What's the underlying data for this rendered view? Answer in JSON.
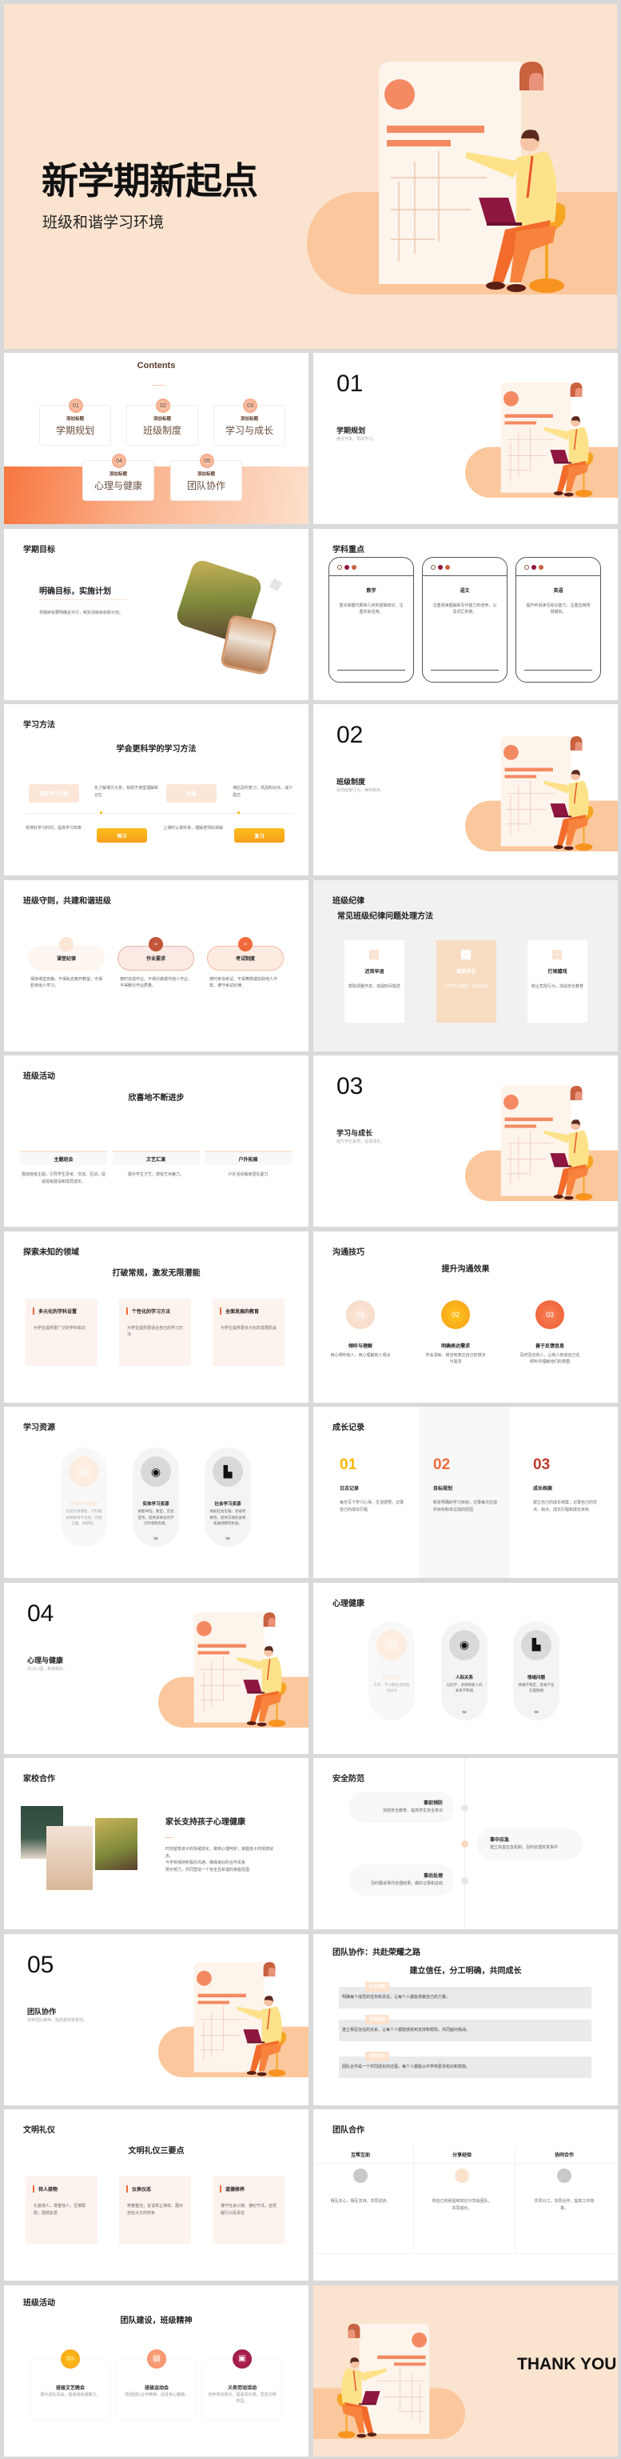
{
  "cover": {
    "title": "新学期新起点",
    "subtitle": "班级和谐学习环境"
  },
  "contents": {
    "title": "Contents",
    "items": [
      {
        "num": "01",
        "tag": "添加标题",
        "label": "学期规划"
      },
      {
        "num": "02",
        "tag": "添加标题",
        "label": "班级制度"
      },
      {
        "num": "03",
        "tag": "添加标题",
        "label": "学习与成长"
      },
      {
        "num": "04",
        "tag": "添加标题",
        "label": "心理与健康"
      },
      {
        "num": "05",
        "tag": "添加标题",
        "label": "团队协作"
      }
    ]
  },
  "sections": [
    {
      "num": "01",
      "title": "学期规划",
      "desc": "继往开来，再启学习。"
    },
    {
      "num": "02",
      "title": "班级制度",
      "desc": "规范班级行为，维持秩序。"
    },
    {
      "num": "03",
      "title": "学习与成长",
      "desc": "提升学生素质，促进成长。"
    },
    {
      "num": "04",
      "title": "心理与健康",
      "desc": "关注心理，和谐相处。"
    },
    {
      "num": "05",
      "title": "团队协作",
      "desc": "培养团队精神，提高整体荣誉感。"
    }
  ],
  "goals": {
    "header": "学期目标",
    "heading": "明确目标，实施计划",
    "body": "学期目标要明确且可行，制定清晰目标和计划。"
  },
  "subjects": {
    "header": "学科重点",
    "items": [
      {
        "title": "数学",
        "text": "重点掌握代数和几何的基础知识，注重实际应用。"
      },
      {
        "title": "语文",
        "text": "注重阅读理解和写作能力的培养，以及词汇积累。"
      },
      {
        "title": "英语",
        "text": "提升听说读写综合能力，注重应用场景模拟。"
      }
    ]
  },
  "methods": {
    "header": "学习方法",
    "heading": "学会更科学的学习方法",
    "steps": [
      {
        "label": "制定学习计划",
        "text": "安排好学习时间，提高学习效率"
      },
      {
        "label": "预习",
        "text": "先了解课文大意，有助于课堂理解和记忆"
      },
      {
        "label": "听课",
        "text": "上课时认真听讲，理解老师的讲解"
      },
      {
        "label": "复习",
        "text": "课后及时复习，巩固知识点，减少遗忘"
      }
    ]
  },
  "rules": {
    "header": "班级守则，共建和谐班级",
    "items": [
      {
        "num": "01",
        "title": "课堂纪律",
        "text": "保持课堂安静，不得私自离开教室，不得影响他人学习。"
      },
      {
        "num": "02",
        "title": "作业要求",
        "text": "按时完成作业，不得抄袭或代他人作业，不得敷衍作业质量。"
      },
      {
        "num": "03",
        "title": "考试制度",
        "text": "按时参加考试，不得舞弊或协助他人作弊，遵守考试纪律。"
      }
    ]
  },
  "discipline": {
    "header": "班级纪律",
    "heading": "常见班级纪律问题处理方法",
    "items": [
      {
        "icon": "01",
        "title": "迟到早退",
        "text": "帮助调整作息，加强时间观念"
      },
      {
        "icon": "02",
        "title": "课堂讲话",
        "text": "引导专注课堂，适当提醒"
      },
      {
        "icon": "03",
        "title": "打闹嬉戏",
        "text": "制止危险行为，加强安全教育"
      }
    ]
  },
  "activities": {
    "header": "班级活动",
    "heading": "欣喜地不断进步",
    "items": [
      {
        "title": "主题班会",
        "text": "围绕班级主题，引导学生思考、交流、互动，促进班级建设和成员成长。"
      },
      {
        "title": "文艺汇演",
        "text": "展示学生才艺，感受艺术魅力。"
      },
      {
        "title": "户外拓展",
        "text": "户外活动锻炼团队能力"
      }
    ]
  },
  "explore": {
    "header": "探索未知的领域",
    "heading": "打破常规，激发无限潜能",
    "items": [
      {
        "title": "多元化的学科设置",
        "text": "为学生提供更广泛的学科知识"
      },
      {
        "title": "个性化的学习方法",
        "text": "为学生提供更适合自己的学习方法"
      },
      {
        "title": "全面发展的教育",
        "text": "为学生提供更多元化的发展机会"
      }
    ]
  },
  "communication": {
    "header": "沟通技巧",
    "heading": "提升沟通效果",
    "items": [
      {
        "num": "01",
        "title": "倾听与理解",
        "text": "用心倾听他人，用心理解他人观点"
      },
      {
        "num": "02",
        "title": "明确表达需求",
        "text": "学会清晰、简洁地表达自己的想法与需求"
      },
      {
        "num": "03",
        "title": "善于反馈信息",
        "text": "及时回应他人，让他人知道自己在倾听并理解他们的意图"
      }
    ]
  },
  "resources": {
    "header": "学习资源",
    "items": [
      {
        "icon": "image-icon",
        "title": "网络学习资源",
        "text": "包括在线课程、学科网站和教育平台等，内容全面、易获取。",
        "num": "01"
      },
      {
        "icon": "webcam-icon",
        "title": "实体学习资源",
        "text": "如图书馆、教室、实验室等，提供多样化的学习环境和资源。",
        "num": "02"
      },
      {
        "icon": "armchair-icon",
        "title": "社会学习资源",
        "text": "例如社会实践、参观考察等，提供实践机会和拓展视野的机会。",
        "num": "03"
      }
    ]
  },
  "growth": {
    "header": "成长记录",
    "items": [
      {
        "num": "01",
        "title": "日志记录",
        "text": "每天写下学习心得、生活感悟，记录自己的成长历程"
      },
      {
        "num": "02",
        "title": "目标规划",
        "text": "制定明确的学习目标，记录每次达成的目标和未达成的原因"
      },
      {
        "num": "03",
        "title": "成长档案",
        "text": "建立自己的成长档案，记录自己的优点、缺点、成长历程和成长目标"
      }
    ]
  },
  "mental": {
    "header": "心理健康",
    "items": [
      {
        "icon": "image-icon",
        "title": "压力过大",
        "text": "工作、学习和生活的压力过大",
        "num": "01"
      },
      {
        "icon": "webcam-icon",
        "title": "人际关系",
        "text": "与同学、老师和家人的关系不和谐",
        "num": "02"
      },
      {
        "icon": "armchair-icon",
        "title": "情绪问题",
        "text": "情绪不稳定，容易产生负面情绪",
        "num": "03"
      }
    ]
  },
  "homeschool": {
    "header": "家校合作",
    "heading": "家长支持孩子心理健康",
    "lines": [
      "时刻留意孩子的情绪变化，做到心理呵护，掌握孩子的情感状态。",
      "与学校保持积极的沟通，确保良好的合作关系",
      "携手努力，共同营造一个安全且和谐的家庭氛围"
    ]
  },
  "safety": {
    "header": "安全防范",
    "items": [
      {
        "title": "事前预防",
        "text": "加强安全教育，提高学生安全意识"
      },
      {
        "title": "事中应急",
        "text": "建立完善应急机制，及时处理突发事件"
      },
      {
        "title": "事后处理",
        "text": "及时跟进事件处理结果，做好记录和总结"
      }
    ]
  },
  "teamroad": {
    "header": "团队协作：共赴荣耀之路",
    "heading": "建立信任，分工明确，共同成长",
    "items": [
      {
        "tag": "分工明确",
        "text": "明确每个成员的任务和责任，让每个人都能贡献自己的力量。"
      },
      {
        "tag": "互相信任",
        "text": "建立相互信任的关系，让每个人都能感受到支持和帮助，共同面对挑战。"
      },
      {
        "tag": "共同成长",
        "text": "团队合作是一个共同成长的过程，每个人都能从中学到更多知识和技能。"
      }
    ]
  },
  "etiquette": {
    "header": "文明礼仪",
    "heading": "文明礼仪三要点",
    "items": [
      {
        "title": "待人接物",
        "text": "礼貌待人，尊重他人，互相帮助，团结友爱"
      },
      {
        "title": "仪表仪态",
        "text": "穿着整洁，言谈举止得体，展示自信大方的形象"
      },
      {
        "title": "道德修养",
        "text": "遵守社会公德，遵纪守法，自觉履行公民责任"
      }
    ]
  },
  "teamwork": {
    "header": "团队合作",
    "items": [
      {
        "title": "互帮互助",
        "text": "相互关心，相互支持，共同进步。"
      },
      {
        "title": "分享经验",
        "text": "将自己的经验和知识分享给团队，共同成长。"
      },
      {
        "title": "协同合作",
        "text": "共同分工，协同合作，提高工作效率。"
      }
    ]
  },
  "classevents": {
    "header": "班级活动",
    "heading": "团队建设，班级精神",
    "items": [
      {
        "icon": "inbox-icon",
        "title": "班级文艺晚会",
        "text": "展示团队风采，提高班级凝聚力。"
      },
      {
        "icon": "ticket-icon",
        "title": "班级运动会",
        "text": "增强团队合作精神，促进身心健康。"
      },
      {
        "icon": "bag-icon",
        "title": "义务劳动活动",
        "text": "培养劳动意识，提高责任感，营造文明校园。"
      }
    ]
  },
  "ending": {
    "text": "THANK YOU"
  },
  "colors": {
    "peach_bg": "#fae3cf",
    "band": "#fbc79c",
    "accent": "#f06a3c",
    "yellow": "#f7b500",
    "maroon": "#8e1640"
  }
}
